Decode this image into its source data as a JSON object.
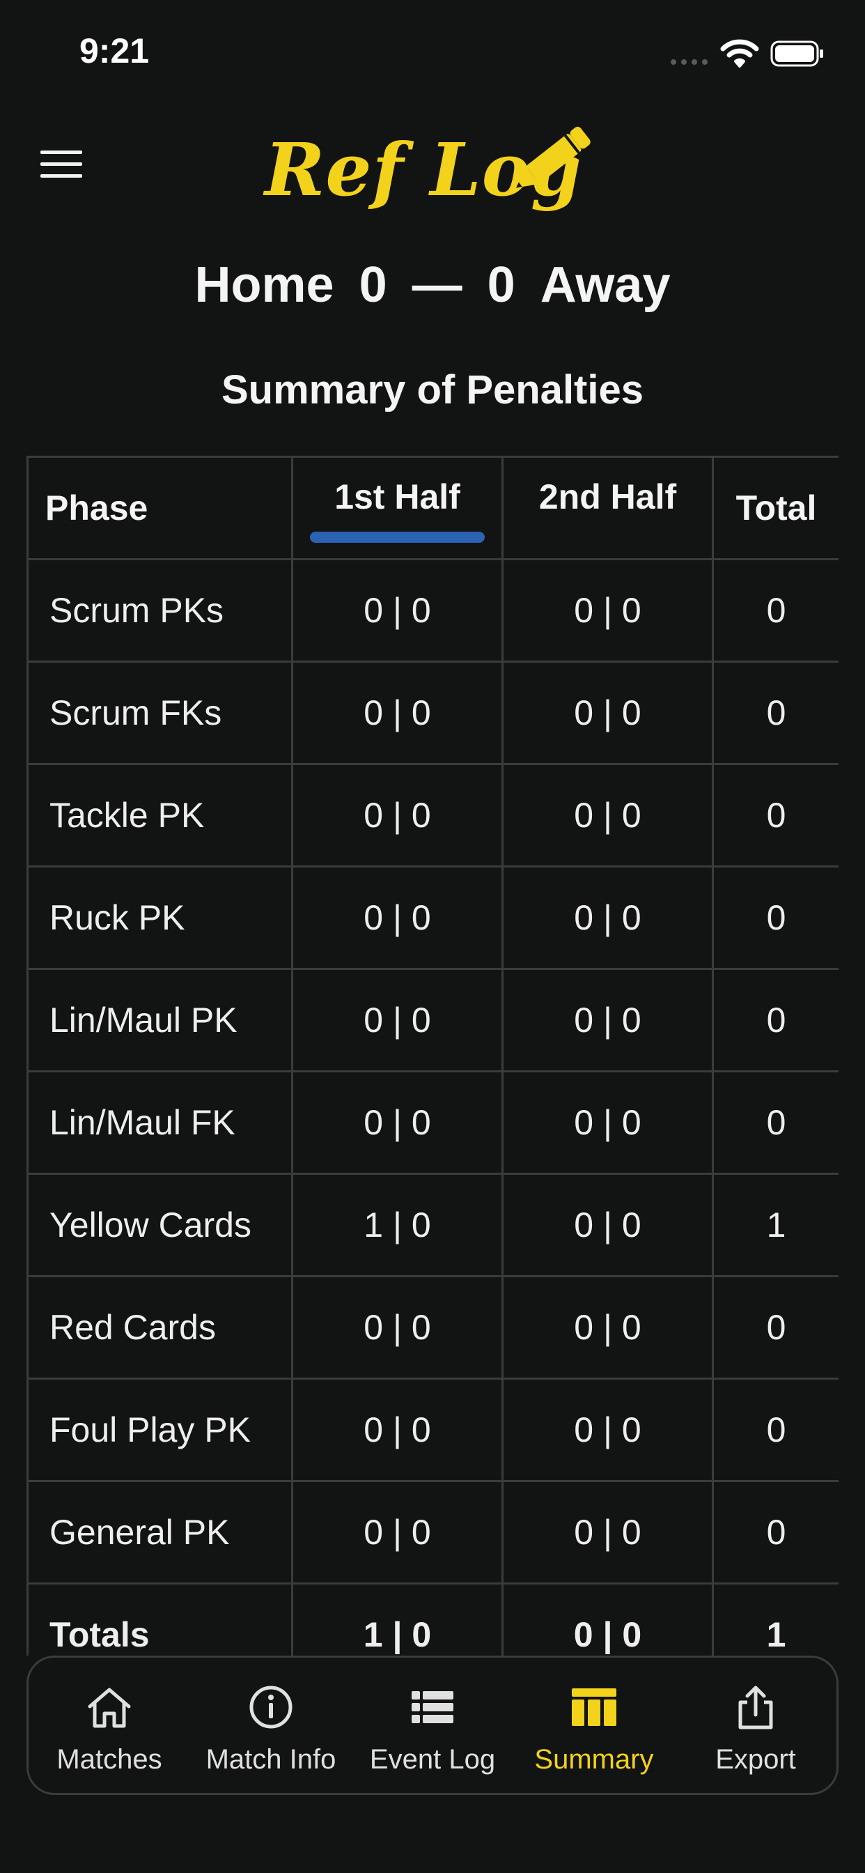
{
  "status_bar": {
    "time": "9:21"
  },
  "header": {
    "logo_text": "Ref Log",
    "home_label": "Home",
    "home_score": "0",
    "separator": "—",
    "away_score": "0",
    "away_label": "Away",
    "section_title": "Summary of Penalties"
  },
  "colors": {
    "accent_yellow": "#f2d21b",
    "tab_indicator_blue": "#2b62b3",
    "background": "#121313",
    "grid_line": "#3a3b3b"
  },
  "table": {
    "headers": {
      "phase": "Phase",
      "first_half": "1st Half",
      "second_half": "2nd Half",
      "total": "Total"
    },
    "active_tab": "1st Half",
    "rows": [
      {
        "phase": "Scrum PKs",
        "first": "0 | 0",
        "second": "0 | 0",
        "total": "0"
      },
      {
        "phase": "Scrum FKs",
        "first": "0 | 0",
        "second": "0 | 0",
        "total": "0"
      },
      {
        "phase": "Tackle PK",
        "first": "0 | 0",
        "second": "0 | 0",
        "total": "0"
      },
      {
        "phase": "Ruck PK",
        "first": "0 | 0",
        "second": "0 | 0",
        "total": "0"
      },
      {
        "phase": "Lin/Maul PK",
        "first": "0 | 0",
        "second": "0 | 0",
        "total": "0"
      },
      {
        "phase": "Lin/Maul FK",
        "first": "0 | 0",
        "second": "0 | 0",
        "total": "0"
      },
      {
        "phase": "Yellow Cards",
        "first": "1 | 0",
        "second": "0 | 0",
        "total": "1"
      },
      {
        "phase": "Red Cards",
        "first": "0 | 0",
        "second": "0 | 0",
        "total": "0"
      },
      {
        "phase": "Foul Play PK",
        "first": "0 | 0",
        "second": "0 | 0",
        "total": "0"
      },
      {
        "phase": "General PK",
        "first": "0 | 0",
        "second": "0 | 0",
        "total": "0"
      }
    ],
    "totals": {
      "phase": "Totals",
      "first": "1 | 0",
      "second": "0 | 0",
      "total": "1"
    }
  },
  "bottom_nav": {
    "items": [
      {
        "label": "Matches",
        "icon": "home-icon"
      },
      {
        "label": "Match Info",
        "icon": "info-circle-icon"
      },
      {
        "label": "Event Log",
        "icon": "list-icon"
      },
      {
        "label": "Summary",
        "icon": "table-icon",
        "active": true
      },
      {
        "label": "Export",
        "icon": "share-icon"
      }
    ]
  }
}
